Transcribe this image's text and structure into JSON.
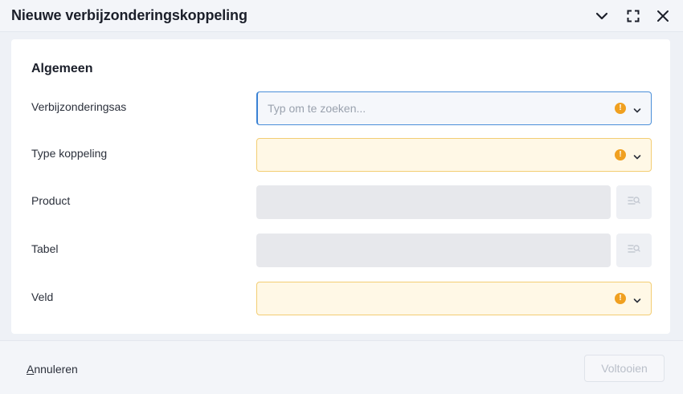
{
  "dialog": {
    "title": "Nieuwe verbijzonderingskoppeling"
  },
  "section": {
    "title": "Algemeen"
  },
  "fields": {
    "verbijzonderingsas": {
      "label": "Verbijzonderingsas",
      "placeholder": "Typ om te zoeken...",
      "status": "warning"
    },
    "type_koppeling": {
      "label": "Type koppeling",
      "status": "warning"
    },
    "product": {
      "label": "Product",
      "disabled": true
    },
    "tabel": {
      "label": "Tabel",
      "disabled": true
    },
    "veld": {
      "label": "Veld",
      "status": "warning"
    }
  },
  "footer": {
    "cancel_accel": "A",
    "cancel_rest": "nnuleren",
    "finish_label": "Voltooien"
  },
  "colors": {
    "warning": "#f0a020",
    "warning_bg": "#fff8e6",
    "focus_border": "#3a82d4",
    "disabled_bg": "#e7e8ec"
  },
  "icons": [
    "chevron-down-icon",
    "maximize-icon",
    "close-icon",
    "warning-icon",
    "lookup-list-search-icon"
  ]
}
